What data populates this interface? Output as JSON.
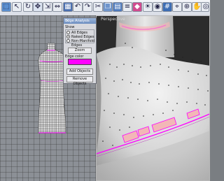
{
  "colors": {
    "edge_color": "#ff00ff",
    "highlight_face": "#f2b7b7",
    "viewport_bg": "#2c2c2c",
    "grid_bg": "#8c9096"
  },
  "viewports": {
    "left_title": "",
    "right_title": "Perspective"
  },
  "panel": {
    "title": "Edge Analysis",
    "show_label": "Show",
    "options": [
      "All Edges",
      "Naked Edges",
      "Non-Manifold Edges"
    ],
    "selected_option": "Naked Edges",
    "zoom_label": "Zoom",
    "edge_color_label": "Edge color",
    "add_objects_label": "Add Objects",
    "remove_objects_label": "Remove Objects"
  },
  "toolbar": {
    "icons": [
      "select-icon",
      "pointer-icon",
      "rotate-icon",
      "move-icon",
      "scale-icon",
      "mirror-icon",
      "array-icon",
      "undo-icon",
      "redo-icon",
      "cut-icon",
      "copy-icon",
      "paste-icon",
      "layer-icon",
      "render-icon",
      "light-icon",
      "camera-icon",
      "grid-icon",
      "snap-icon",
      "zoom-icon",
      "pan-icon",
      "orbit-icon",
      "help-icon"
    ]
  }
}
